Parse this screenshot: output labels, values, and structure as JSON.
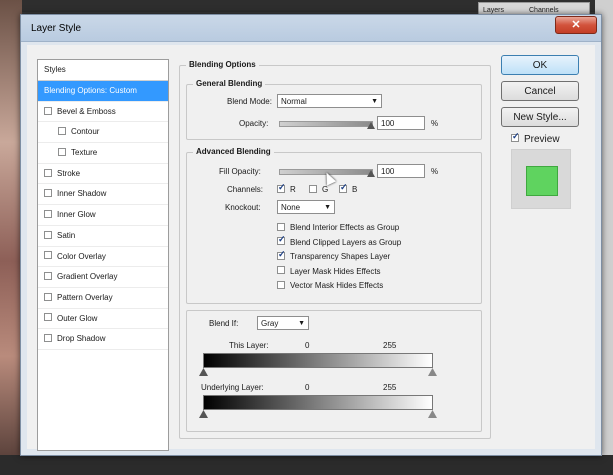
{
  "window": {
    "title": "Layer Style",
    "close_glyph": "✕"
  },
  "background": {
    "tab1": "Layers",
    "tab2": "Channels"
  },
  "styles": {
    "header": "Styles",
    "items": [
      {
        "label": "Blending Options: Custom",
        "selected": true,
        "checkbox": false,
        "indent": false
      },
      {
        "label": "Bevel & Emboss",
        "checkbox": true,
        "checked": false,
        "indent": false
      },
      {
        "label": "Contour",
        "checkbox": true,
        "checked": false,
        "indent": true
      },
      {
        "label": "Texture",
        "checkbox": true,
        "checked": false,
        "indent": true
      },
      {
        "label": "Stroke",
        "checkbox": true,
        "checked": false,
        "indent": false
      },
      {
        "label": "Inner Shadow",
        "checkbox": true,
        "checked": false,
        "indent": false
      },
      {
        "label": "Inner Glow",
        "checkbox": true,
        "checked": false,
        "indent": false
      },
      {
        "label": "Satin",
        "checkbox": true,
        "checked": false,
        "indent": false
      },
      {
        "label": "Color Overlay",
        "checkbox": true,
        "checked": false,
        "indent": false
      },
      {
        "label": "Gradient Overlay",
        "checkbox": true,
        "checked": false,
        "indent": false
      },
      {
        "label": "Pattern Overlay",
        "checkbox": true,
        "checked": false,
        "indent": false
      },
      {
        "label": "Outer Glow",
        "checkbox": true,
        "checked": false,
        "indent": false
      },
      {
        "label": "Drop Shadow",
        "checkbox": true,
        "checked": false,
        "indent": false
      }
    ]
  },
  "blending": {
    "section_title": "Blending Options",
    "general_title": "General Blending",
    "blend_mode_label": "Blend Mode:",
    "blend_mode_value": "Normal",
    "opacity_label": "Opacity:",
    "opacity_value": "100",
    "percent": "%",
    "advanced_title": "Advanced Blending",
    "fill_opacity_label": "Fill Opacity:",
    "fill_opacity_value": "100",
    "channels_label": "Channels:",
    "channel_r": "R",
    "channel_g": "G",
    "channel_b": "B",
    "knockout_label": "Knockout:",
    "knockout_value": "None",
    "options": [
      {
        "label": "Blend Interior Effects as Group",
        "checked": false
      },
      {
        "label": "Blend Clipped Layers as Group",
        "checked": true
      },
      {
        "label": "Transparency Shapes Layer",
        "checked": true
      },
      {
        "label": "Layer Mask Hides Effects",
        "checked": false
      },
      {
        "label": "Vector Mask Hides Effects",
        "checked": false
      }
    ],
    "blend_if_label": "Blend If:",
    "blend_if_value": "Gray",
    "this_layer_label": "This Layer:",
    "underlying_label": "Underlying Layer:",
    "range_min": "0",
    "range_max": "255"
  },
  "buttons": {
    "ok": "OK",
    "cancel": "Cancel",
    "new_style": "New Style...",
    "preview": "Preview"
  },
  "colors": {
    "preview_swatch": "#5fd35f",
    "selection": "#3399ff"
  }
}
